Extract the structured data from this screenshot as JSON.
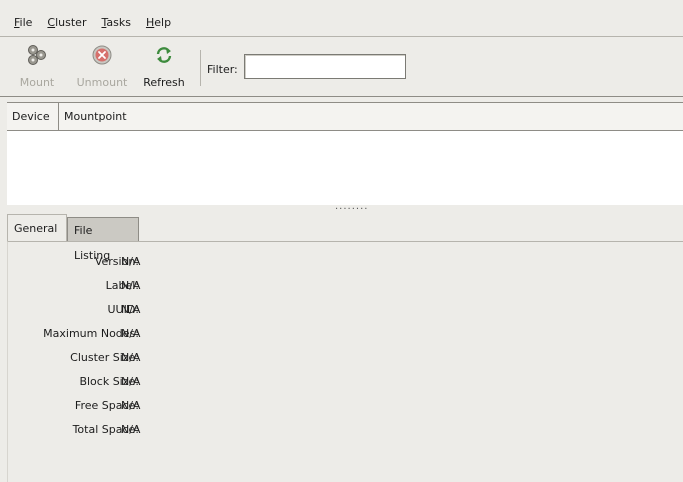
{
  "menubar": {
    "items": [
      {
        "mnemonic": "F",
        "rest": "ile"
      },
      {
        "mnemonic": "C",
        "rest": "luster"
      },
      {
        "mnemonic": "T",
        "rest": "asks"
      },
      {
        "mnemonic": "H",
        "rest": "elp"
      }
    ]
  },
  "toolbar": {
    "mount_label": "Mount",
    "unmount_label": "Unmount",
    "refresh_label": "Refresh",
    "filter_label": "Filter:",
    "filter_value": ""
  },
  "tree": {
    "columns": [
      "Device",
      "Mountpoint"
    ],
    "rows": []
  },
  "pane_handle": "........",
  "tabs": [
    "General",
    "File Listing"
  ],
  "general": {
    "rows": [
      {
        "key": "Version:",
        "value": "N/A"
      },
      {
        "key": "Label:",
        "value": "N/A"
      },
      {
        "key": "UUID:",
        "value": "N/A"
      },
      {
        "key": "Maximum Nodes:",
        "value": "N/A"
      },
      {
        "key": "Cluster Size:",
        "value": "N/A"
      },
      {
        "key": "Block Size:",
        "value": "N/A"
      },
      {
        "key": "Free Space:",
        "value": "N/A"
      },
      {
        "key": "Total Space:",
        "value": "N/A"
      }
    ]
  },
  "colors": {
    "window_bg": "#edece8",
    "disabled_text": "#a9a79f",
    "unmount_icon": "#d9534f",
    "refresh_icon": "#3d8b3d"
  }
}
